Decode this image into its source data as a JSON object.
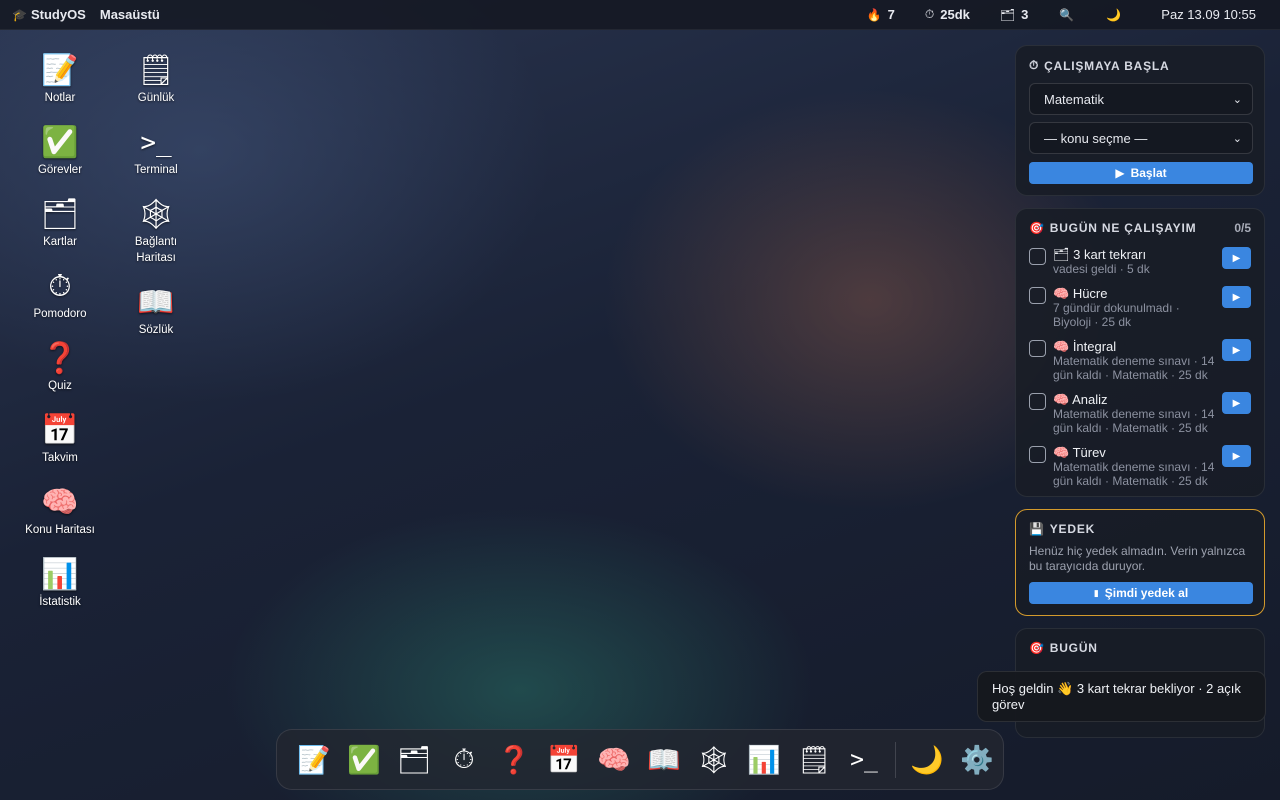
{
  "topbar": {
    "brand_icon": "graduation-cap-icon",
    "brand_glyph": "🎓",
    "brand": "StudyOS",
    "desktop_label": "Masaüstü",
    "streak_glyph": "🔥",
    "streak": "7",
    "timer_glyph": "⏱",
    "study_time": "25dk",
    "cards_glyph": "🗂",
    "cards": "3",
    "search_glyph": "🔍",
    "theme_glyph": "🌙",
    "clock": "Paz 13.09 10:55"
  },
  "desktop": {
    "col1": [
      {
        "glyph": "📝",
        "label": "Notlar"
      },
      {
        "glyph": "✅",
        "label": "Görevler"
      },
      {
        "glyph": "🗂",
        "label": "Kartlar"
      },
      {
        "glyph": "⏱",
        "label": "Pomodoro"
      },
      {
        "glyph": "❓",
        "label": "Quiz"
      },
      {
        "glyph": "📅",
        "label": "Takvim"
      },
      {
        "glyph": "🧠",
        "label": "Konu Haritası"
      },
      {
        "glyph": "📊",
        "label": "İstatistik"
      }
    ],
    "col2": [
      {
        "glyph": "🗒",
        "label": "Günlük"
      },
      {
        "glyph": ">_",
        "label": "Terminal"
      },
      {
        "glyph": "🕸",
        "label": "Bağlantı Haritası"
      },
      {
        "glyph": "📖",
        "label": "Sözlük"
      }
    ]
  },
  "start_panel": {
    "icon": "⏱",
    "title": "ÇALIŞMAYA BAŞLA",
    "subject": "Matematik",
    "topic": "— konu seçme —",
    "start_button": "Başlat"
  },
  "today_panel": {
    "icon": "🎯",
    "title": "BUGÜN NE ÇALIŞAYIM",
    "count": "0/5",
    "tasks": [
      {
        "icon": "🗂",
        "name": "3 kart tekrarı",
        "sub": "vadesi geldi · 5 dk"
      },
      {
        "icon": "🧠",
        "name": "Hücre",
        "sub": "7 gündür dokunulmadı · Biyoloji · 25 dk"
      },
      {
        "icon": "🧠",
        "name": "İntegral",
        "sub": "Matematik deneme sınavı · 14 gün kaldı · Matematik · 25 dk"
      },
      {
        "icon": "🧠",
        "name": "Analiz",
        "sub": "Matematik deneme sınavı · 14 gün kaldı · Matematik · 25 dk"
      },
      {
        "icon": "🧠",
        "name": "Türev",
        "sub": "Matematik deneme sınavı · 14 gün kaldı · Matematik · 25 dk"
      }
    ]
  },
  "backup_panel": {
    "icon": "💾",
    "title": "YEDEK",
    "desc": "Henüz hiç yedek almadın. Verin yalnızca bu tarayıcıda duruyor.",
    "button": "Şimdi yedek al"
  },
  "stats_panel": {
    "icon": "🎯",
    "title": "BUGÜN"
  },
  "toast": {
    "text": "Hoş geldin 👋 3 kart tekrar bekliyor · 2 açık görev"
  },
  "dock": {
    "items": [
      "📝",
      "✅",
      "🗂",
      "⏱",
      "❓",
      "📅",
      "🧠",
      "📖",
      "🕸",
      "📊",
      "🗒",
      ">_"
    ],
    "extras": [
      "🌙",
      "⚙️"
    ]
  }
}
